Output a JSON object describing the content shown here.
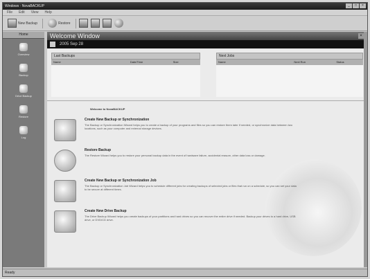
{
  "window": {
    "title": "Windows · NovaBACKUP",
    "controls": [
      "_",
      "□",
      "×"
    ]
  },
  "menu": [
    "File",
    "Edit",
    "View",
    "Help"
  ],
  "toolbar": {
    "buttons": [
      {
        "label": "New Backup",
        "icon": "backup-icon"
      },
      {
        "label": "Restore",
        "icon": "restore-icon"
      }
    ]
  },
  "sidebar": {
    "header": "Home",
    "items": [
      {
        "label": "Overview",
        "icon": "overview-icon"
      },
      {
        "label": "Backup",
        "icon": "backup-icon"
      },
      {
        "label": "Drive Backup",
        "icon": "drive-backup-icon"
      },
      {
        "label": "Restore",
        "icon": "restore-icon"
      },
      {
        "label": "Log",
        "icon": "log-icon"
      }
    ]
  },
  "main": {
    "title": "Welcome Window",
    "date": "2005 Sep 28",
    "last_backups": {
      "header": "Last Backups",
      "columns": [
        "Name",
        "Date/Time",
        "Size"
      ]
    },
    "next_jobs": {
      "header": "Next Jobs",
      "columns": [
        "Name",
        "Next Run",
        "Status"
      ]
    },
    "welcome_text": "Welcome to NovaBACKUP",
    "tasks": [
      {
        "name": "Create New Backup or Synchronization",
        "desc": "The Backup or Synchronization Wizard helps you to create a backup of your programs and files so you can restore them later if needed, or synchronize data between two locations, such as your computer and external storage devices."
      },
      {
        "name": "Restore Backup",
        "desc": "The Restore Wizard helps you to restore your personal backup data in the event of hardware failure, accidental erasure, other data loss or damage."
      },
      {
        "name": "Create New Backup or Synchronization Job",
        "desc": "The Backup or Synchronization Job Wizard helps you to schedule different jobs for creating backups of selected jobs or files that run on a schedule, so you can set your data to be secure at different times."
      },
      {
        "name": "Create New Drive Backup",
        "desc": "The Drive Backup Wizard helps you create backups of your partitions and hard drives so you can recover the entire drive if needed. Backup your drives to a hard drive, USB drive, or DVD/CD drive."
      }
    ]
  },
  "status": {
    "text": "Ready"
  }
}
